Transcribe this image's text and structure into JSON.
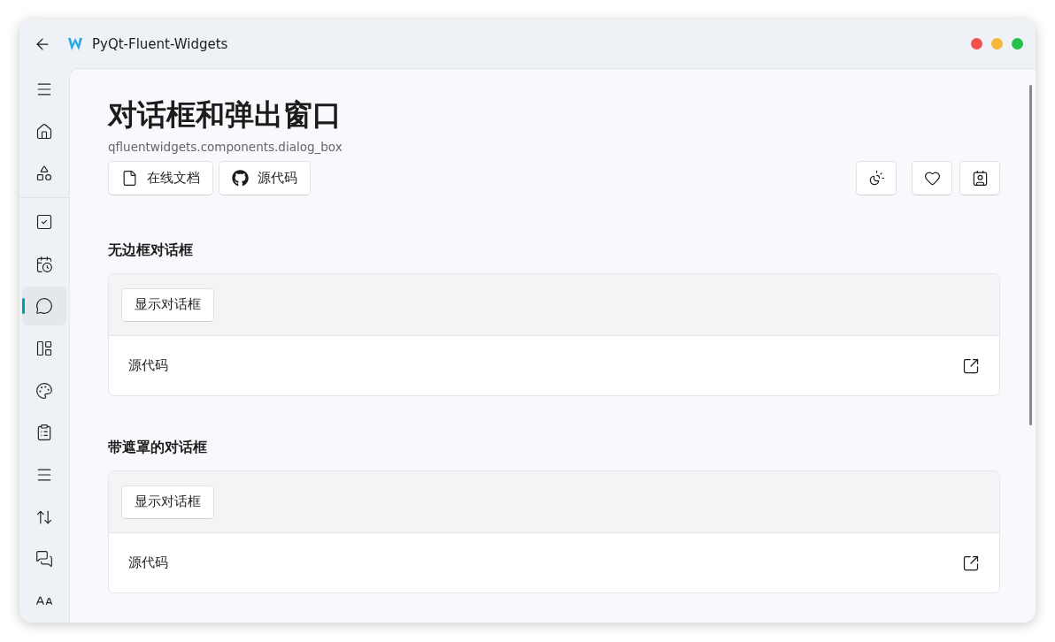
{
  "window": {
    "title": "PyQt-Fluent-Widgets"
  },
  "sidebar": {
    "items": [
      {
        "kind": "menu",
        "selected": false
      },
      {
        "kind": "home",
        "selected": false
      },
      {
        "kind": "shapes",
        "selected": false
      },
      {
        "kind": "checkbox",
        "selected": false
      },
      {
        "kind": "calendar",
        "selected": false
      },
      {
        "kind": "chat",
        "selected": true
      },
      {
        "kind": "layout",
        "selected": false
      },
      {
        "kind": "palette",
        "selected": false
      },
      {
        "kind": "clipboard",
        "selected": false
      },
      {
        "kind": "menu",
        "selected": false
      },
      {
        "kind": "sort",
        "selected": false
      },
      {
        "kind": "chats",
        "selected": false
      },
      {
        "kind": "text",
        "selected": false
      }
    ]
  },
  "header": {
    "title": "对话框和弹出窗口",
    "subtitle": "qfluentwidgets.components.dialog_box",
    "links": [
      {
        "kind": "doc",
        "label": "在线文档"
      },
      {
        "kind": "github",
        "label": "源代码"
      }
    ],
    "tools": [
      {
        "kind": "theme"
      },
      {
        "kind": "heart"
      },
      {
        "kind": "feedback"
      }
    ]
  },
  "sections": [
    {
      "title": "无边框对话框",
      "button": "显示对话框",
      "source": "源代码"
    },
    {
      "title": "带遮罩的对话框",
      "button": "显示对话框",
      "source": "源代码"
    }
  ]
}
